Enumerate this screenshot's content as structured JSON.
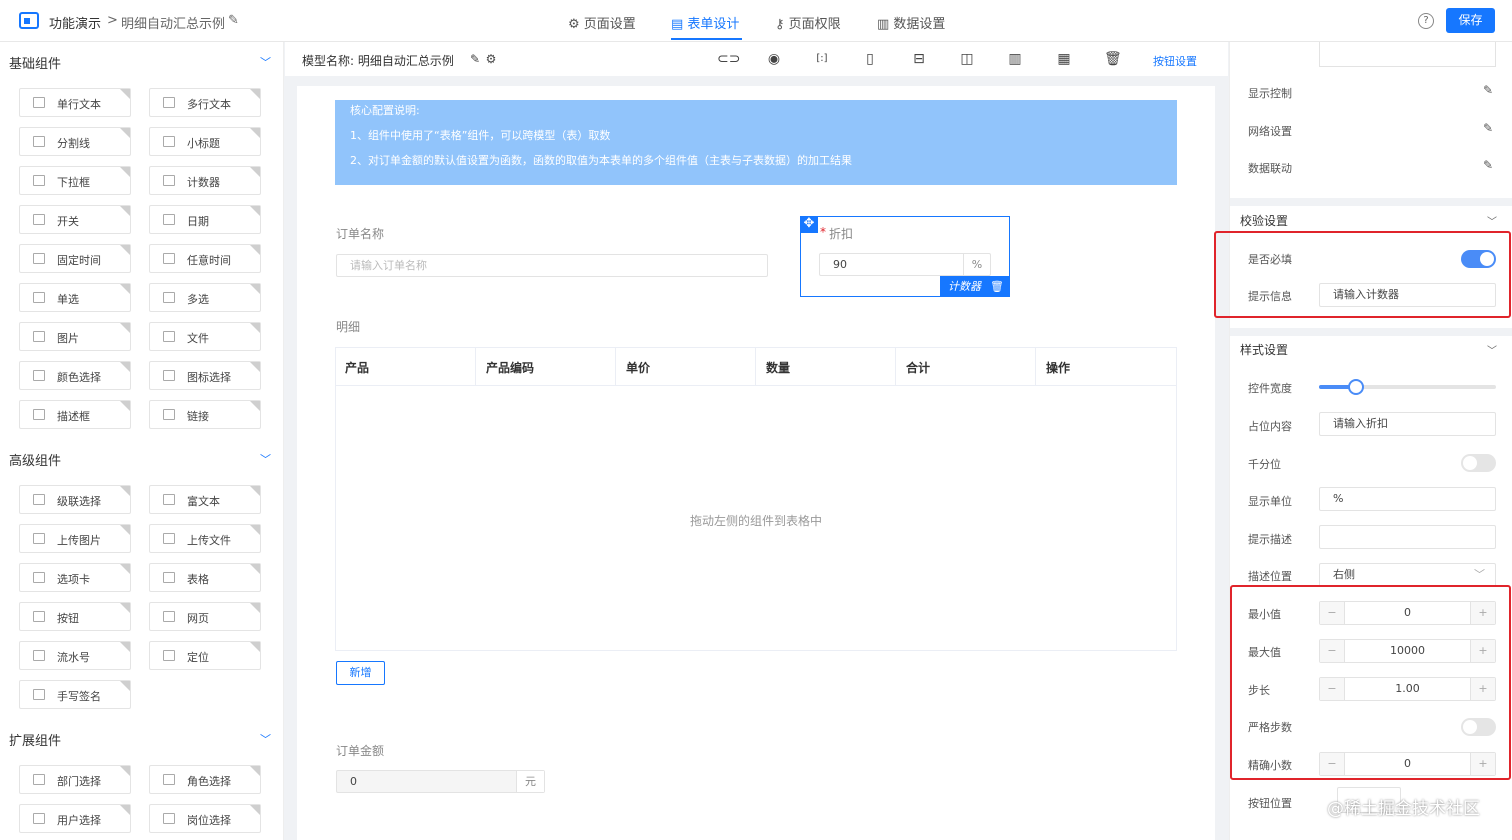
{
  "topbar": {
    "app_name": "功能演示",
    "breadcrumb_sep": ">",
    "page_name": "明细自动汇总示例",
    "tabs": [
      {
        "label": "页面设置",
        "icon": "gear-icon"
      },
      {
        "label": "表单设计",
        "icon": "document-icon"
      },
      {
        "label": "页面权限",
        "icon": "key-icon"
      },
      {
        "label": "数据设置",
        "icon": "bar-chart-icon"
      }
    ],
    "active_tab": "表单设计",
    "help": "?",
    "save_label": "保存"
  },
  "left_panel": {
    "sections": [
      {
        "title": "基础组件",
        "items": [
          "单行文本",
          "多行文本",
          "分割线",
          "小标题",
          "下拉框",
          "计数器",
          "开关",
          "日期",
          "固定时间",
          "任意时间",
          "单选",
          "多选",
          "图片",
          "文件",
          "颜色选择",
          "图标选择",
          "描述框",
          "链接"
        ]
      },
      {
        "title": "高级组件",
        "items": [
          "级联选择",
          "富文本",
          "上传图片",
          "上传文件",
          "选项卡",
          "表格",
          "按钮",
          "网页",
          "流水号",
          "定位",
          "手写签名"
        ]
      },
      {
        "title": "扩展组件",
        "items": [
          "部门选择",
          "角色选择",
          "用户选择",
          "岗位选择"
        ]
      }
    ]
  },
  "toolbar": {
    "model_label": "模型名称: 明细自动汇总示例",
    "tools": [
      "link-icon",
      "eye-icon",
      "code-icon",
      "tablet-icon",
      "layout-rows-icon",
      "layout-2col-icon",
      "layout-3col-icon",
      "layout-4col-icon",
      "trash-icon"
    ],
    "button_settings": "按钮设置"
  },
  "canvas": {
    "note": {
      "title": "核心配置说明:",
      "line1": "1、组件中使用了“表格”组件，可以跨模型（表）取数",
      "line2": "2、对订单金额的默认值设置为函数，函数的取值为本表单的多个组件值（主表与子表数据）的加工结果"
    },
    "order_name": {
      "label": "订单名称",
      "placeholder": "请输入订单名称"
    },
    "discount": {
      "required_mark": "*",
      "label": "折扣",
      "value": "90",
      "unit": "%",
      "tag": "计数器"
    },
    "detail": {
      "label": "明细",
      "columns": [
        "产品",
        "产品编码",
        "单价",
        "数量",
        "合计",
        "操作"
      ],
      "empty_text": "拖动左侧的组件到表格中",
      "add_label": "新增"
    },
    "order_amount": {
      "label": "订单金额",
      "value": "0",
      "unit": "元"
    }
  },
  "right_panel": {
    "links": [
      {
        "label": "显示控制"
      },
      {
        "label": "网络设置"
      },
      {
        "label": "数据联动"
      }
    ],
    "validation": {
      "title": "校验设置",
      "required_label": "是否必填",
      "required_on": true,
      "hint_label": "提示信息",
      "hint_value": "请输入计数器"
    },
    "style": {
      "title": "样式设置",
      "width_label": "控件宽度",
      "width_fraction": 0.21,
      "placeholder_label": "占位内容",
      "placeholder_value": "请输入折扣",
      "thousands_label": "千分位",
      "thousands_on": false,
      "unit_label": "显示单位",
      "unit_value": "%",
      "desc_label": "提示描述",
      "desc_value": "",
      "desc_pos_label": "描述位置",
      "desc_pos_value": "右侧",
      "min_label": "最小值",
      "min_value": "0",
      "max_label": "最大值",
      "max_value": "10000",
      "step_label": "步长",
      "step_value": "1.00",
      "strict_label": "严格步数",
      "strict_on": false,
      "precision_label": "精确小数",
      "precision_value": "0",
      "btnpos_label": "按钮位置"
    }
  },
  "watermark": "@稀土掘金技术社区",
  "colors": {
    "primary": "#1677ff",
    "highlight": "#e0242b",
    "note_bg": "#91c4fb"
  }
}
